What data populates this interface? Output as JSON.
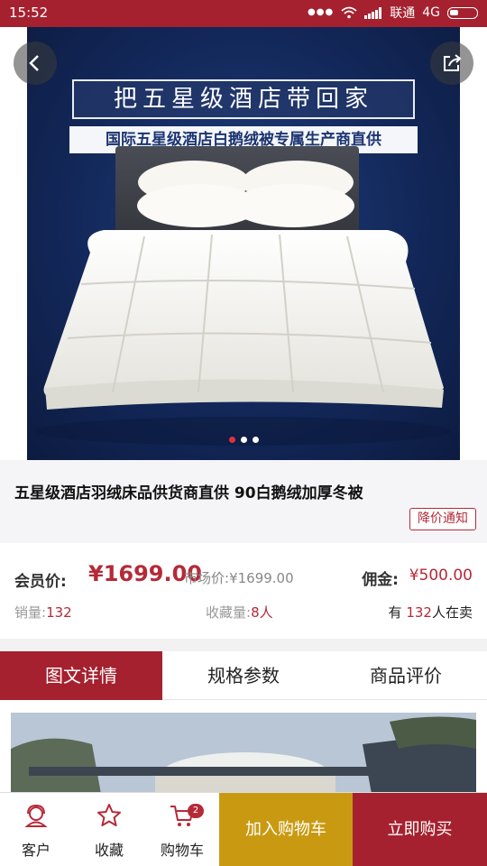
{
  "status_bar": {
    "time": "15:52",
    "carrier": "联通",
    "network": "4G"
  },
  "hero": {
    "banner_title": "把五星级酒店带回家",
    "banner_subtitle": "国际五星级酒店白鹅绒被专属生产商直供",
    "carousel_count": 3,
    "carousel_active": 0
  },
  "product": {
    "title": "五星级酒店羽绒床品供货商直供 90白鹅绒加厚冬被",
    "notify_label": "降价通知"
  },
  "price": {
    "member_label": "会员价:",
    "member_price": "¥1699.00",
    "market_label": "市场价:",
    "market_price": "¥1699.00",
    "commission_label": "佣金:",
    "commission_value": "¥500.00",
    "sales_label": "销量:",
    "sales_value": "132",
    "fav_label": "收藏量:",
    "fav_value": "8人",
    "sellers_prefix": "有",
    "sellers_value": "132",
    "sellers_suffix": "人在卖"
  },
  "tabs": [
    {
      "label": "图文详情",
      "active": true
    },
    {
      "label": "规格参数",
      "active": false
    },
    {
      "label": "商品评价",
      "active": false
    }
  ],
  "bottom_bar": {
    "service_label": "客户",
    "favorite_label": "收藏",
    "cart_label": "购物车",
    "cart_count": "2",
    "add_cart_label": "加入购物车",
    "buy_now_label": "立即购买"
  },
  "colors": {
    "brand_red": "#a5212f",
    "gold": "#c99a11",
    "accent_red": "#b52a38"
  },
  "icons": [
    "back-icon",
    "share-icon",
    "customer-service-icon",
    "star-icon",
    "cart-icon",
    "wifi-icon",
    "signal-icon",
    "battery-icon"
  ]
}
